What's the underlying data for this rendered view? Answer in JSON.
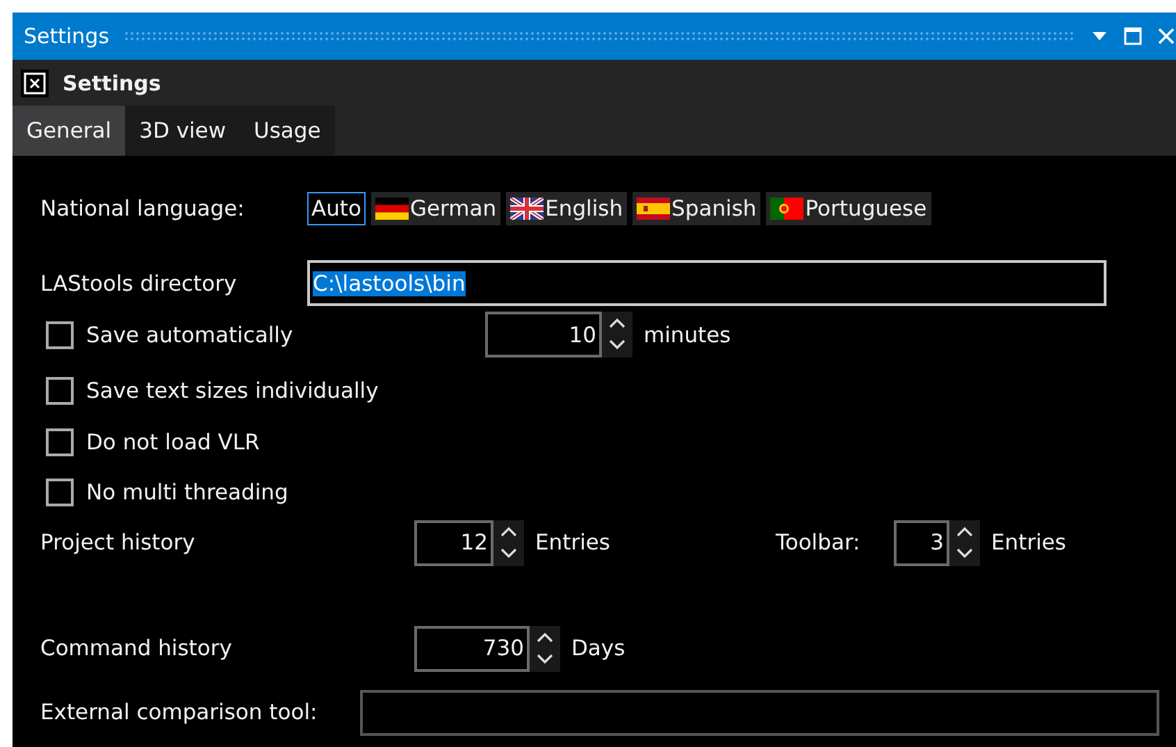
{
  "window": {
    "title": "Settings"
  },
  "panel": {
    "title": "Settings"
  },
  "tabs": [
    {
      "label": "General",
      "selected": true
    },
    {
      "label": "3D view",
      "selected": false
    },
    {
      "label": "Usage",
      "selected": false
    }
  ],
  "language": {
    "label": "National language:",
    "options": [
      {
        "label": "Auto",
        "selected": true
      },
      {
        "label": "German",
        "selected": false
      },
      {
        "label": "English",
        "selected": false
      },
      {
        "label": "Spanish",
        "selected": false
      },
      {
        "label": "Portuguese",
        "selected": false
      }
    ]
  },
  "lastools_directory": {
    "label": "LAStools directory",
    "value": "C:\\lastools\\bin"
  },
  "checkboxes": [
    {
      "label": "Save automatically",
      "checked": false
    },
    {
      "label": "Save text sizes individually",
      "checked": false
    },
    {
      "label": "Do not load VLR",
      "checked": false
    },
    {
      "label": "No multi threading",
      "checked": false
    }
  ],
  "save_interval": {
    "value": "10",
    "unit": "minutes"
  },
  "project_history": {
    "label": "Project history",
    "value": "12",
    "unit": "Entries"
  },
  "toolbar": {
    "label": "Toolbar:",
    "value": "3",
    "unit": "Entries"
  },
  "command_history": {
    "label": "Command history",
    "value": "730",
    "unit": "Days"
  },
  "external_tool": {
    "label": "External comparison tool:"
  }
}
